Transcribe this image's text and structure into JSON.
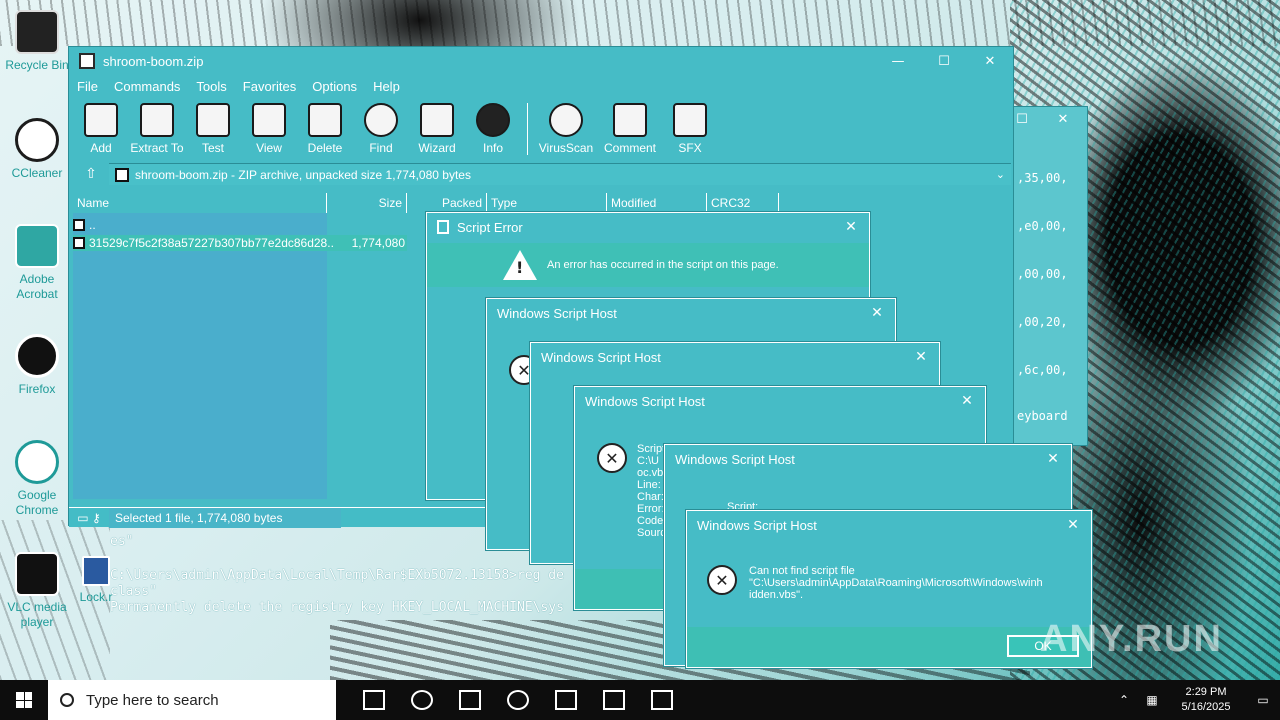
{
  "desktop": {
    "icons": [
      {
        "label": "Recycle Bin",
        "icon": "recycle-bin-icon"
      },
      {
        "label": "CCleaner",
        "icon": "ccleaner-icon"
      },
      {
        "label": "Adobe Acrobat",
        "icon": "acrobat-icon"
      },
      {
        "label": "Firefox",
        "icon": "firefox-icon"
      },
      {
        "label": "Google Chrome",
        "icon": "chrome-icon"
      },
      {
        "label": "VLC media player",
        "icon": "vlc-icon"
      },
      {
        "label": "Lock.r",
        "icon": "word-doc-icon"
      }
    ]
  },
  "winrar": {
    "title": "shroom-boom.zip",
    "menu": [
      "File",
      "Commands",
      "Tools",
      "Favorites",
      "Options",
      "Help"
    ],
    "toolbar": [
      "Add",
      "Extract To",
      "Test",
      "View",
      "Delete",
      "Find",
      "Wizard",
      "Info",
      "VirusScan",
      "Comment",
      "SFX"
    ],
    "path": "shroom-boom.zip - ZIP archive, unpacked size 1,774,080 bytes",
    "columns": [
      "Name",
      "Size",
      "Packed",
      "Type",
      "Modified",
      "CRC32"
    ],
    "rows": [
      {
        "name": "..",
        "size": ""
      },
      {
        "name": "31529c7f5c2f38a57227b307bb77e2dc86d28...",
        "size": "1,774,080"
      }
    ],
    "status": "Selected 1 file, 1,774,080 bytes"
  },
  "terminal": {
    "line1": "es\"",
    "line2": "C:\\Users\\admin\\AppData\\Local\\Temp\\Rar$EXb5072.13158>reg de",
    "line3": "class\"",
    "line4": "Permanently delete the registry key HKEY_LOCAL_MACHINE\\sys"
  },
  "hex_window": {
    "lines": [
      ",35,00,",
      ",e0,00,",
      ",00,00,",
      ",00,20,",
      ",6c,00,",
      "eyboard"
    ]
  },
  "dialogs": {
    "script_error": {
      "title": "Script Error",
      "message": "An error has occurred in the script on this page."
    },
    "wsh1": {
      "title": "Windows Script Host"
    },
    "wsh2": {
      "title": "Windows Script Host"
    },
    "wsh3": {
      "title": "Windows Script Host",
      "lines": [
        "Script:",
        "C:\\U",
        "oc.vb",
        "Line:",
        "Char:",
        "Error:",
        "Code:",
        "Sourc"
      ]
    },
    "wsh4": {
      "title": "Windows Script Host",
      "script_label": "Script:"
    },
    "wsh5": {
      "title": "Windows Script Host",
      "message_line1": "Can not find script file",
      "message_line2": "\"C:\\Users\\admin\\AppData\\Roaming\\Microsoft\\Windows\\winh",
      "message_line3": "idden.vbs\".",
      "ok": "OK"
    }
  },
  "taskbar": {
    "search_placeholder": "Type here to search",
    "time": "2:29 PM",
    "date": "5/16/2025"
  },
  "watermark": "ANY.RUN",
  "colors": {
    "window": "#46bcc6",
    "accent": "#3fc0b6",
    "taskbar": "#0d0d0d"
  }
}
